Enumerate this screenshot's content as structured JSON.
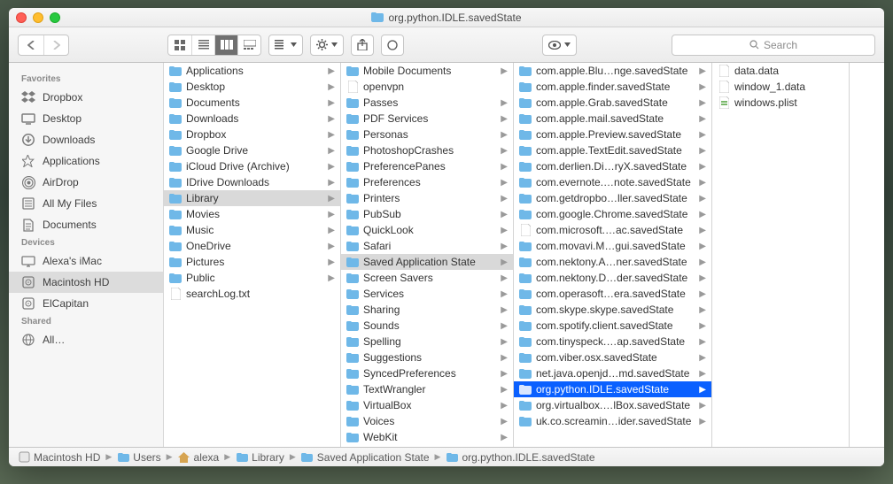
{
  "title": "org.python.IDLE.savedState",
  "search_placeholder": "Search",
  "sidebar": {
    "sections": [
      {
        "header": "Favorites",
        "items": [
          {
            "icon": "dropbox",
            "label": "Dropbox"
          },
          {
            "icon": "desktop",
            "label": "Desktop"
          },
          {
            "icon": "downloads",
            "label": "Downloads"
          },
          {
            "icon": "applications",
            "label": "Applications"
          },
          {
            "icon": "airdrop",
            "label": "AirDrop"
          },
          {
            "icon": "allmyfiles",
            "label": "All My Files"
          },
          {
            "icon": "documents",
            "label": "Documents"
          }
        ]
      },
      {
        "header": "Devices",
        "items": [
          {
            "icon": "imac",
            "label": "Alexa's iMac"
          },
          {
            "icon": "hdd",
            "label": "Macintosh HD",
            "selected": true
          },
          {
            "icon": "hdd",
            "label": "ElCapitan"
          }
        ]
      },
      {
        "header": "Shared",
        "items": [
          {
            "icon": "globe",
            "label": "All…"
          }
        ]
      }
    ]
  },
  "col1": [
    {
      "t": "folder",
      "l": "Applications",
      "a": true
    },
    {
      "t": "folder",
      "l": "Desktop",
      "a": true
    },
    {
      "t": "folder",
      "l": "Documents",
      "a": true
    },
    {
      "t": "folder",
      "l": "Downloads",
      "a": true
    },
    {
      "t": "folder",
      "l": "Dropbox",
      "a": true
    },
    {
      "t": "folder",
      "l": "Google Drive",
      "a": true
    },
    {
      "t": "folder",
      "l": "iCloud Drive (Archive)",
      "a": true
    },
    {
      "t": "folder",
      "l": "IDrive Downloads",
      "a": true
    },
    {
      "t": "folder-l",
      "l": "Library",
      "a": true,
      "sel": true
    },
    {
      "t": "folder",
      "l": "Movies",
      "a": true
    },
    {
      "t": "folder",
      "l": "Music",
      "a": true
    },
    {
      "t": "folder",
      "l": "OneDrive",
      "a": true
    },
    {
      "t": "folder",
      "l": "Pictures",
      "a": true
    },
    {
      "t": "folder",
      "l": "Public",
      "a": true
    },
    {
      "t": "file",
      "l": "searchLog.txt"
    }
  ],
  "col2": [
    {
      "t": "folder",
      "l": "Mobile Documents",
      "a": true
    },
    {
      "t": "file",
      "l": "openvpn"
    },
    {
      "t": "folder",
      "l": "Passes",
      "a": true
    },
    {
      "t": "folder",
      "l": "PDF Services",
      "a": true
    },
    {
      "t": "folder",
      "l": "Personas",
      "a": true
    },
    {
      "t": "folder",
      "l": "PhotoshopCrashes",
      "a": true
    },
    {
      "t": "folder",
      "l": "PreferencePanes",
      "a": true
    },
    {
      "t": "folder",
      "l": "Preferences",
      "a": true
    },
    {
      "t": "folder",
      "l": "Printers",
      "a": true
    },
    {
      "t": "folder",
      "l": "PubSub",
      "a": true
    },
    {
      "t": "folder",
      "l": "QuickLook",
      "a": true
    },
    {
      "t": "folder",
      "l": "Safari",
      "a": true
    },
    {
      "t": "folder",
      "l": "Saved Application State",
      "a": true,
      "sel": true
    },
    {
      "t": "folder",
      "l": "Screen Savers",
      "a": true
    },
    {
      "t": "folder",
      "l": "Services",
      "a": true
    },
    {
      "t": "folder",
      "l": "Sharing",
      "a": true
    },
    {
      "t": "folder",
      "l": "Sounds",
      "a": true
    },
    {
      "t": "folder",
      "l": "Spelling",
      "a": true
    },
    {
      "t": "folder",
      "l": "Suggestions",
      "a": true
    },
    {
      "t": "folder",
      "l": "SyncedPreferences",
      "a": true
    },
    {
      "t": "folder",
      "l": "TextWrangler",
      "a": true
    },
    {
      "t": "folder",
      "l": "VirtualBox",
      "a": true
    },
    {
      "t": "folder",
      "l": "Voices",
      "a": true
    },
    {
      "t": "folder",
      "l": "WebKit",
      "a": true
    }
  ],
  "col3": [
    {
      "t": "folder",
      "l": "com.apple.Blu…nge.savedState",
      "a": true
    },
    {
      "t": "folder",
      "l": "com.apple.finder.savedState",
      "a": true
    },
    {
      "t": "folder",
      "l": "com.apple.Grab.savedState",
      "a": true
    },
    {
      "t": "folder",
      "l": "com.apple.mail.savedState",
      "a": true
    },
    {
      "t": "folder",
      "l": "com.apple.Preview.savedState",
      "a": true
    },
    {
      "t": "folder",
      "l": "com.apple.TextEdit.savedState",
      "a": true
    },
    {
      "t": "folder",
      "l": "com.derlien.Di…ryX.savedState",
      "a": true
    },
    {
      "t": "folder",
      "l": "com.evernote.…note.savedState",
      "a": true
    },
    {
      "t": "folder",
      "l": "com.getdropbo…ller.savedState",
      "a": true
    },
    {
      "t": "folder",
      "l": "com.google.Chrome.savedState",
      "a": true
    },
    {
      "t": "file",
      "l": "com.microsoft.…ac.savedState",
      "a": true
    },
    {
      "t": "folder",
      "l": "com.movavi.M…gui.savedState",
      "a": true
    },
    {
      "t": "folder",
      "l": "com.nektony.A…ner.savedState",
      "a": true
    },
    {
      "t": "folder",
      "l": "com.nektony.D…der.savedState",
      "a": true
    },
    {
      "t": "folder",
      "l": "com.operasoft…era.savedState",
      "a": true
    },
    {
      "t": "folder",
      "l": "com.skype.skype.savedState",
      "a": true
    },
    {
      "t": "folder",
      "l": "com.spotify.client.savedState",
      "a": true
    },
    {
      "t": "folder",
      "l": "com.tinyspeck.…ap.savedState",
      "a": true
    },
    {
      "t": "folder",
      "l": "com.viber.osx.savedState",
      "a": true
    },
    {
      "t": "folder",
      "l": "net.java.openjd…md.savedState",
      "a": true
    },
    {
      "t": "folder",
      "l": "org.python.IDLE.savedState",
      "a": true,
      "sel": true,
      "blue": true
    },
    {
      "t": "folder",
      "l": "org.virtualbox.…lBox.savedState",
      "a": true
    },
    {
      "t": "folder",
      "l": "uk.co.screamin…ider.savedState",
      "a": true
    }
  ],
  "col4": [
    {
      "t": "file",
      "l": "data.data"
    },
    {
      "t": "file",
      "l": "window_1.data"
    },
    {
      "t": "plist",
      "l": "windows.plist"
    }
  ],
  "pathbar": [
    {
      "icon": "hdd",
      "l": "Macintosh HD"
    },
    {
      "icon": "folder",
      "l": "Users"
    },
    {
      "icon": "home",
      "l": "alexa"
    },
    {
      "icon": "folder",
      "l": "Library"
    },
    {
      "icon": "folder",
      "l": "Saved Application State"
    },
    {
      "icon": "folder",
      "l": "org.python.IDLE.savedState"
    }
  ]
}
